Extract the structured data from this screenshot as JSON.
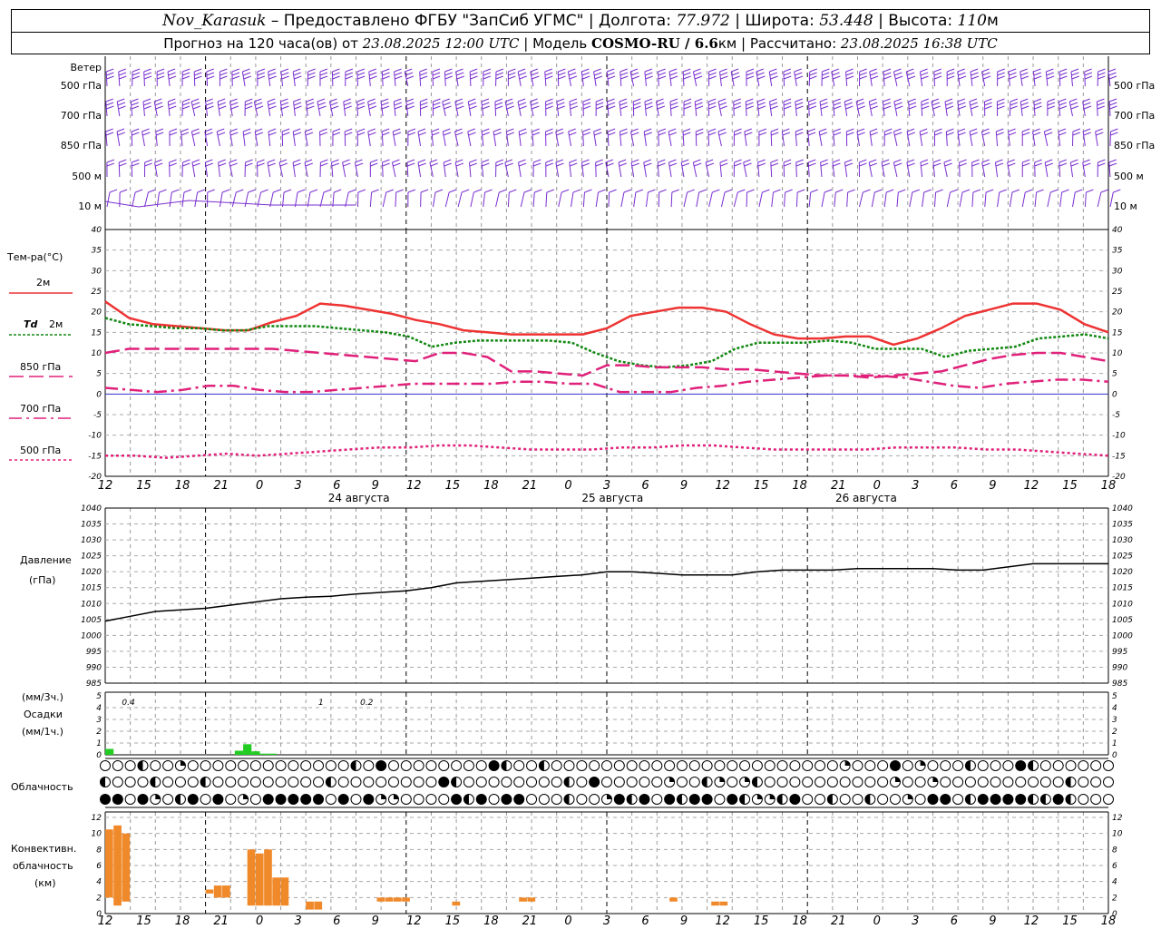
{
  "header": {
    "station": "Nov_Karasuk",
    "provider": " – Предоставлено ФГБУ \"ЗапСиб УГМС\" | Долгота: ",
    "lon": "77.972",
    "lat_label": " | Широта: ",
    "lat": "53.448",
    "alt_label": " | Высота: ",
    "alt": "110",
    "alt_unit": "м",
    "forecast_label": "Прогноз на 120 часа(ов) от ",
    "forecast_start": "23.08.2025 12:00 UTC",
    "model_label": "  | Модель ",
    "model": "COSMO-RU / 6.6",
    "model_unit": "км",
    "calc_label": " | Рассчитано: ",
    "calc_time": "23.08.2025 16:38 UTC"
  },
  "panel_labels": {
    "wind": "Ветер",
    "temp": "Тем-ра(°C)",
    "t2m": "2м",
    "td": "Td",
    "td_lev": "2м",
    "t850": "850 гПа",
    "t700": "700 гПа",
    "t500": "500 гПа",
    "pressure1": "Давление",
    "pressure2": "(гПа)",
    "precip1": "(мм/3ч.)",
    "precip2": "Осадки",
    "precip3": "(мм/1ч.)",
    "cloud": "Облачность",
    "conv1": "Конвективн.",
    "conv2": "облачность",
    "conv3": "(км)"
  },
  "wind_levels": [
    "500 гПа",
    "700 гПа",
    "850 гПа",
    "500 м",
    "10 м"
  ],
  "x_ticks": [
    "12",
    "15",
    "18",
    "21",
    "0",
    "3",
    "6",
    "9",
    "12",
    "15",
    "18",
    "21",
    "0",
    "3",
    "6",
    "9",
    "12",
    "15",
    "18",
    "21",
    "0",
    "3",
    "6",
    "9",
    "12",
    "15",
    "18"
  ],
  "dates": [
    "24 августа",
    "25 августа",
    "26 августа"
  ],
  "colors": {
    "t2m": "#ee3333",
    "td": "#118811",
    "t850": "#e0207a",
    "t700": "#e0207a",
    "t500": "#e0207a",
    "pressure": "#000000",
    "precip": "#22cc22",
    "conv": "#f0892a",
    "wind": "#7a2ed0",
    "zero": "#3333cc"
  },
  "chart_data": [
    {
      "type": "line",
      "panel": "temperature",
      "x_hours": [
        0,
        3,
        6,
        9,
        12,
        15,
        18,
        21,
        24,
        27,
        30,
        33,
        36,
        39,
        42,
        45,
        48,
        51,
        54,
        57,
        60,
        63,
        66,
        69,
        72,
        75,
        78,
        81,
        84,
        87,
        90,
        93,
        96,
        99,
        102,
        105,
        108,
        111,
        114,
        117,
        120
      ],
      "ylim": [
        -20,
        40
      ],
      "series": [
        {
          "name": "2м",
          "values": [
            22.5,
            18.5,
            17,
            16.5,
            16,
            15.5,
            15.5,
            17.5,
            19,
            22,
            21.5,
            20.5,
            19.5,
            18,
            17,
            15.5,
            15,
            14.5,
            14.5,
            14.5,
            14.5,
            16,
            19,
            20,
            21,
            21,
            20,
            17,
            14.5,
            13.5,
            13.5,
            14,
            14,
            12,
            13.5,
            16,
            19,
            20.5,
            22,
            22,
            20.5,
            17,
            15
          ]
        },
        {
          "name": "Td 2м",
          "values": [
            18.5,
            17,
            16.5,
            16,
            16,
            15.5,
            15.5,
            16.5,
            16.5,
            16.5,
            16,
            15.5,
            15,
            14,
            11.5,
            12.5,
            13,
            13,
            13,
            13,
            12.5,
            10,
            8,
            7,
            6.5,
            7,
            8,
            11,
            12.5,
            12.5,
            12.5,
            13,
            12.5,
            11,
            11,
            11,
            9,
            10.5,
            11,
            11.5,
            13.5,
            14,
            14.5,
            13.5
          ]
        },
        {
          "name": "850 гПа",
          "values": [
            10,
            11,
            11,
            11,
            11,
            11,
            11,
            11,
            10.5,
            10,
            9.5,
            9,
            8.5,
            8,
            10,
            10,
            9,
            5.5,
            5.5,
            5,
            4.5,
            7,
            7,
            6.5,
            6.5,
            6.5,
            6,
            6,
            5.5,
            5,
            4.5,
            4.5,
            4,
            4.5,
            5,
            5.5,
            7,
            8.5,
            9.5,
            10,
            10,
            9,
            8
          ]
        },
        {
          "name": "700 гПа",
          "values": [
            1.5,
            1,
            0.5,
            1,
            2,
            2,
            1,
            0.5,
            0.5,
            1,
            1.5,
            2,
            2.5,
            2.5,
            2.5,
            2.5,
            3,
            3,
            2.5,
            2.5,
            0.5,
            0.5,
            0.5,
            1.5,
            2,
            3,
            3.5,
            4,
            4.5,
            4.5,
            4.5,
            4,
            3,
            2,
            1.5,
            2.5,
            3,
            3.5,
            3.5,
            3
          ]
        },
        {
          "name": "500 гПа",
          "values": [
            -15,
            -15,
            -15.5,
            -15,
            -14.5,
            -15,
            -14.5,
            -14,
            -13.5,
            -13,
            -13,
            -12.5,
            -12.5,
            -13,
            -13.5,
            -13.5,
            -13.5,
            -13,
            -13,
            -12.5,
            -12.5,
            -13,
            -13.5,
            -13.5,
            -13.5,
            -13.5,
            -13,
            -13,
            -13,
            -13.5,
            -13.5,
            -14,
            -14.5,
            -15
          ]
        }
      ]
    },
    {
      "type": "line",
      "panel": "pressure",
      "ylim": [
        985,
        1040
      ],
      "ylabel": "Давление (гПа)",
      "x_hours": [
        0,
        3,
        6,
        9,
        12,
        15,
        18,
        21,
        24,
        27,
        30,
        33,
        36,
        39,
        42,
        45,
        48,
        51,
        54,
        57,
        60,
        63,
        66,
        69,
        72,
        75,
        78,
        81,
        84,
        87,
        90,
        93,
        96,
        99,
        102,
        105,
        108,
        111,
        114,
        117,
        120
      ],
      "values": [
        1004.5,
        1006,
        1007.5,
        1008,
        1008.5,
        1009.5,
        1010.5,
        1011.5,
        1012,
        1012.3,
        1013,
        1013.5,
        1014,
        1015,
        1016.5,
        1017,
        1017.5,
        1018,
        1018.5,
        1019,
        1020,
        1020,
        1019.5,
        1019,
        1019,
        1019,
        1020,
        1020.5,
        1020.5,
        1020.5,
        1021,
        1021,
        1021,
        1021,
        1020.5,
        1020.5,
        1021.5,
        1022.5,
        1022.5,
        1022.5,
        1022.5
      ]
    },
    {
      "type": "bar",
      "panel": "precipitation",
      "ylim": [
        0,
        5
      ],
      "annotations": [
        "0.4",
        "1",
        "0.2"
      ],
      "bars": [
        {
          "h": 0,
          "v": 0.5
        },
        {
          "h": 15.5,
          "v": 0.35
        },
        {
          "h": 16.5,
          "v": 0.9
        },
        {
          "h": 17.5,
          "v": 0.3
        },
        {
          "h": 18.5,
          "v": 0.1
        },
        {
          "h": 19.5,
          "v": 0.1
        }
      ]
    },
    {
      "type": "bar",
      "panel": "convective_cloud",
      "ylim": [
        0,
        12
      ],
      "ylabel": "Конвективн. облачность (км)",
      "bars": [
        {
          "h": 0,
          "top": 10.5,
          "base": 2
        },
        {
          "h": 1,
          "top": 11,
          "base": 1
        },
        {
          "h": 2,
          "top": 10,
          "base": 1.5
        },
        {
          "h": 12,
          "top": 3,
          "base": 2.5
        },
        {
          "h": 13,
          "top": 3.5,
          "base": 2
        },
        {
          "h": 14,
          "top": 3.5,
          "base": 2
        },
        {
          "h": 17,
          "top": 8,
          "base": 1
        },
        {
          "h": 18,
          "top": 7.5,
          "base": 1
        },
        {
          "h": 19,
          "top": 8,
          "base": 1
        },
        {
          "h": 20,
          "top": 4.5,
          "base": 1
        },
        {
          "h": 21,
          "top": 4.5,
          "base": 1
        },
        {
          "h": 24,
          "top": 1.5,
          "base": 0.5
        },
        {
          "h": 25,
          "top": 1.5,
          "base": 0.5
        },
        {
          "h": 32.5,
          "top": 2,
          "base": 1.5
        },
        {
          "h": 33.5,
          "top": 2,
          "base": 1.5
        },
        {
          "h": 34.5,
          "top": 2,
          "base": 1.5
        },
        {
          "h": 35.5,
          "top": 2,
          "base": 1.5
        },
        {
          "h": 41.5,
          "top": 1.5,
          "base": 1
        },
        {
          "h": 49.5,
          "top": 2,
          "base": 1.5
        },
        {
          "h": 50.5,
          "top": 2,
          "base": 1.5
        },
        {
          "h": 67.5,
          "top": 2,
          "base": 1.5
        },
        {
          "h": 72.5,
          "top": 1.5,
          "base": 1
        },
        {
          "h": 73.5,
          "top": 1.5,
          "base": 1
        }
      ]
    }
  ]
}
